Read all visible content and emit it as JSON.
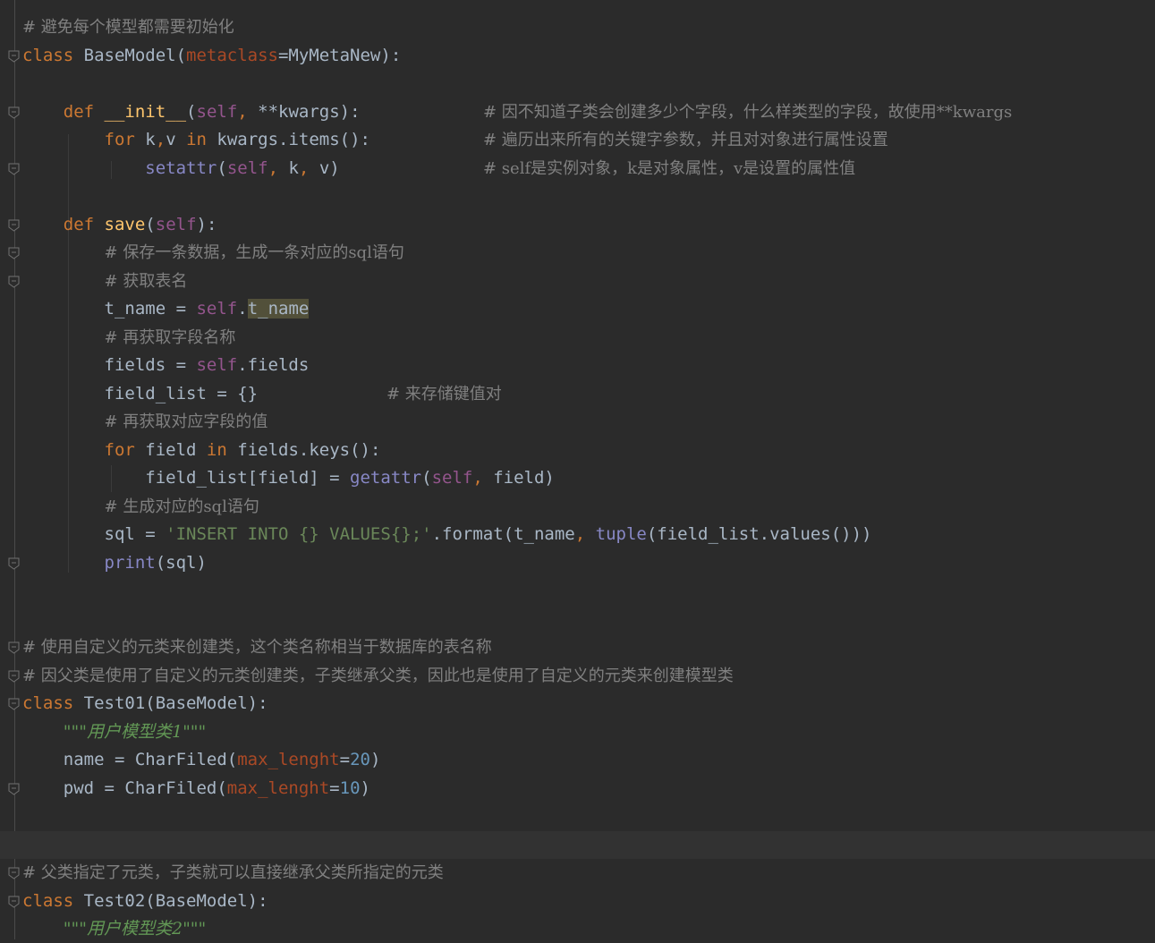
{
  "colors": {
    "background": "#2b2b2b",
    "keyword": "#cc7832",
    "function": "#ffc66d",
    "self": "#94558d",
    "builtin": "#8888c6",
    "parameter": "#aa4926",
    "number": "#6897bb",
    "string": "#6a8759",
    "comment": "#808080",
    "text": "#a9b7c6"
  },
  "lines": [
    {
      "tokens": [
        {
          "t": "com",
          "v": "# 避免每个模型都需要初始化"
        }
      ]
    },
    {
      "tokens": [
        {
          "t": "kw",
          "v": "class "
        },
        {
          "t": "id",
          "v": "BaseModel("
        },
        {
          "t": "par",
          "v": "metaclass"
        },
        {
          "t": "id",
          "v": "=MyMetaNew):"
        }
      ]
    },
    {
      "tokens": []
    },
    {
      "tokens": [
        {
          "t": "id",
          "v": "    "
        },
        {
          "t": "kw",
          "v": "def "
        },
        {
          "t": "fn",
          "v": "__init__"
        },
        {
          "t": "id",
          "v": "("
        },
        {
          "t": "mag",
          "v": "self"
        },
        {
          "t": "kw",
          "v": ", "
        },
        {
          "t": "id",
          "v": "**kwargs):"
        }
      ],
      "comment": "# 因不知道子类会创建多少个字段，什么样类型的字段，故使用**kwargs"
    },
    {
      "tokens": [
        {
          "t": "id",
          "v": "        "
        },
        {
          "t": "kw",
          "v": "for "
        },
        {
          "t": "id",
          "v": "k"
        },
        {
          "t": "kw",
          "v": ","
        },
        {
          "t": "id",
          "v": "v "
        },
        {
          "t": "kw",
          "v": "in "
        },
        {
          "t": "id",
          "v": "kwargs.items():"
        }
      ],
      "comment": "# 遍历出来所有的关键字参数，并且对对象进行属性设置"
    },
    {
      "tokens": [
        {
          "t": "id",
          "v": "            "
        },
        {
          "t": "bi",
          "v": "setattr"
        },
        {
          "t": "id",
          "v": "("
        },
        {
          "t": "mag",
          "v": "self"
        },
        {
          "t": "kw",
          "v": ", "
        },
        {
          "t": "id",
          "v": "k"
        },
        {
          "t": "kw",
          "v": ", "
        },
        {
          "t": "id",
          "v": "v)"
        }
      ],
      "comment": "# self是实例对象，k是对象属性，v是设置的属性值"
    },
    {
      "tokens": []
    },
    {
      "tokens": [
        {
          "t": "id",
          "v": "    "
        },
        {
          "t": "kw",
          "v": "def "
        },
        {
          "t": "fn",
          "v": "save"
        },
        {
          "t": "id",
          "v": "("
        },
        {
          "t": "mag",
          "v": "self"
        },
        {
          "t": "id",
          "v": "):"
        }
      ]
    },
    {
      "tokens": [
        {
          "t": "id",
          "v": "        "
        },
        {
          "t": "com",
          "v": "# 保存一条数据，生成一条对应的sql语句"
        }
      ]
    },
    {
      "tokens": [
        {
          "t": "id",
          "v": "        "
        },
        {
          "t": "com",
          "v": "# 获取表名"
        }
      ]
    },
    {
      "tokens": [
        {
          "t": "id",
          "v": "        t_name = "
        },
        {
          "t": "mag",
          "v": "self"
        },
        {
          "t": "id",
          "v": "."
        },
        {
          "t": "hl",
          "v": "t_name"
        }
      ]
    },
    {
      "tokens": [
        {
          "t": "id",
          "v": "        "
        },
        {
          "t": "com",
          "v": "# 再获取字段名称"
        }
      ]
    },
    {
      "tokens": [
        {
          "t": "id",
          "v": "        fields = "
        },
        {
          "t": "mag",
          "v": "self"
        },
        {
          "t": "id",
          "v": ".fields"
        }
      ]
    },
    {
      "tokens": [
        {
          "t": "id",
          "v": "        field_list = {}"
        }
      ],
      "comment": "# 来存储键值对",
      "comment_pos": "mid"
    },
    {
      "tokens": [
        {
          "t": "id",
          "v": "        "
        },
        {
          "t": "com",
          "v": "# 再获取对应字段的值"
        }
      ]
    },
    {
      "tokens": [
        {
          "t": "id",
          "v": "        "
        },
        {
          "t": "kw",
          "v": "for "
        },
        {
          "t": "id",
          "v": "field "
        },
        {
          "t": "kw",
          "v": "in "
        },
        {
          "t": "id",
          "v": "fields.keys():"
        }
      ]
    },
    {
      "tokens": [
        {
          "t": "id",
          "v": "            field_list[field] = "
        },
        {
          "t": "bi",
          "v": "getattr"
        },
        {
          "t": "id",
          "v": "("
        },
        {
          "t": "mag",
          "v": "self"
        },
        {
          "t": "kw",
          "v": ", "
        },
        {
          "t": "id",
          "v": "field)"
        }
      ]
    },
    {
      "tokens": [
        {
          "t": "id",
          "v": "        "
        },
        {
          "t": "com",
          "v": "# 生成对应的sql语句"
        }
      ]
    },
    {
      "tokens": [
        {
          "t": "id",
          "v": "        sql = "
        },
        {
          "t": "str",
          "v": "'INSERT INTO {} VALUES{};'"
        },
        {
          "t": "id",
          "v": ".format(t_name"
        },
        {
          "t": "kw",
          "v": ", "
        },
        {
          "t": "bi",
          "v": "tuple"
        },
        {
          "t": "id",
          "v": "(field_list.values()))"
        }
      ]
    },
    {
      "tokens": [
        {
          "t": "id",
          "v": "        "
        },
        {
          "t": "bi",
          "v": "print"
        },
        {
          "t": "id",
          "v": "(sql)"
        }
      ]
    },
    {
      "tokens": []
    },
    {
      "tokens": []
    },
    {
      "tokens": [
        {
          "t": "com",
          "v": "# 使用自定义的元类来创建类，这个类名称相当于数据库的表名称"
        }
      ]
    },
    {
      "tokens": [
        {
          "t": "com",
          "v": "# 因父类是使用了自定义的元类创建类，子类继承父类，因此也是使用了自定义的元类来创建模型类"
        }
      ]
    },
    {
      "tokens": [
        {
          "t": "kw",
          "v": "class "
        },
        {
          "t": "id",
          "v": "Test01(BaseModel):"
        }
      ]
    },
    {
      "tokens": [
        {
          "t": "id",
          "v": "    "
        },
        {
          "t": "doc",
          "v": "\"\"\"用户模型类1\"\"\""
        }
      ]
    },
    {
      "tokens": [
        {
          "t": "id",
          "v": "    name = CharFiled("
        },
        {
          "t": "par",
          "v": "max_lenght"
        },
        {
          "t": "id",
          "v": "="
        },
        {
          "t": "num",
          "v": "20"
        },
        {
          "t": "id",
          "v": ")"
        }
      ]
    },
    {
      "tokens": [
        {
          "t": "id",
          "v": "    pwd = CharFiled("
        },
        {
          "t": "par",
          "v": "max_lenght"
        },
        {
          "t": "id",
          "v": "="
        },
        {
          "t": "num",
          "v": "10"
        },
        {
          "t": "id",
          "v": ")"
        }
      ]
    },
    {
      "tokens": []
    },
    {
      "tokens": [],
      "current": true
    },
    {
      "tokens": [
        {
          "t": "com",
          "v": "# 父类指定了元类，子类就可以直接继承父类所指定的元类"
        }
      ]
    },
    {
      "tokens": [
        {
          "t": "kw",
          "v": "class "
        },
        {
          "t": "id",
          "v": "Test02(BaseModel):"
        }
      ]
    },
    {
      "tokens": [
        {
          "t": "id",
          "v": "    "
        },
        {
          "t": "doc",
          "v": "\"\"\"用户模型类2\"\"\""
        }
      ]
    }
  ]
}
